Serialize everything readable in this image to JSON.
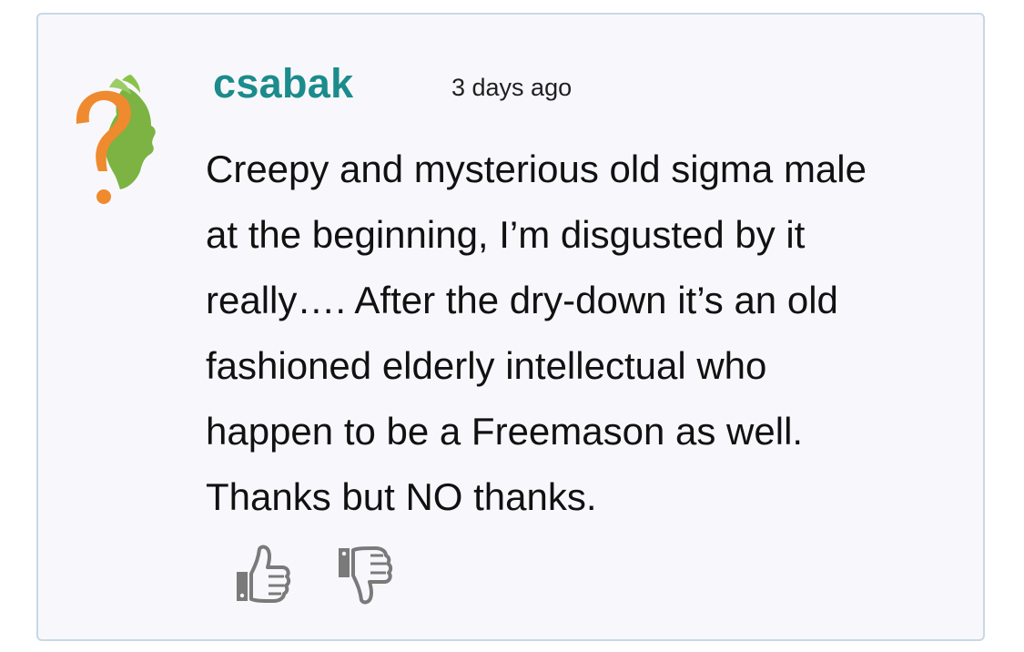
{
  "comment": {
    "username": "csabak",
    "timestamp": "3 days ago",
    "body_lines": [
      "Creepy and mysterious old sigma male",
      "at the beginning, I’m disgusted by it",
      "really…. After the dry-down it’s an old",
      "fashioned elderly intellectual who",
      "happen to be a Freemason as well.",
      "Thanks but NO thanks."
    ]
  },
  "avatar": {
    "icon": "question-mark-head-icon",
    "colors": {
      "question_mark": "#ef8a2f",
      "head": "#7cb342"
    }
  },
  "actions": {
    "like_icon": "thumbs-up-icon",
    "dislike_icon": "thumbs-down-icon",
    "icon_color": "#7a7a7a"
  },
  "theme": {
    "username_color": "#1c8b8c",
    "card_background": "#f8f8fc",
    "card_border": "#c9d7e6"
  }
}
